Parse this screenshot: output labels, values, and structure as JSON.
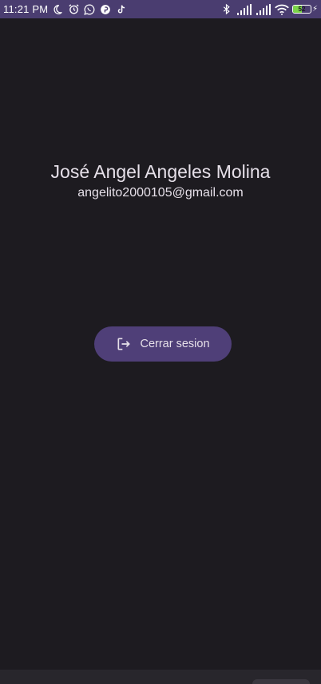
{
  "status_bar": {
    "time": "11:21 PM",
    "left_icons": [
      "moon-icon",
      "alarm-icon",
      "whatsapp-icon",
      "pinterest-icon",
      "tiktok-icon"
    ],
    "right_icons": [
      "bluetooth-icon",
      "signal-icon",
      "signal-icon",
      "wifi-icon"
    ],
    "battery_level": "52",
    "battery_fraction": 0.52,
    "accent_color": "#4a3d70"
  },
  "profile": {
    "name": "José Angel Angeles Molina",
    "email": "angelito2000105@gmail.com"
  },
  "actions": {
    "logout_label": "Cerrar sesion",
    "logout_icon": "logout-icon",
    "button_color": "#4f3f78"
  },
  "theme": {
    "background": "#1d1b20",
    "text": "#e6e0e9"
  }
}
